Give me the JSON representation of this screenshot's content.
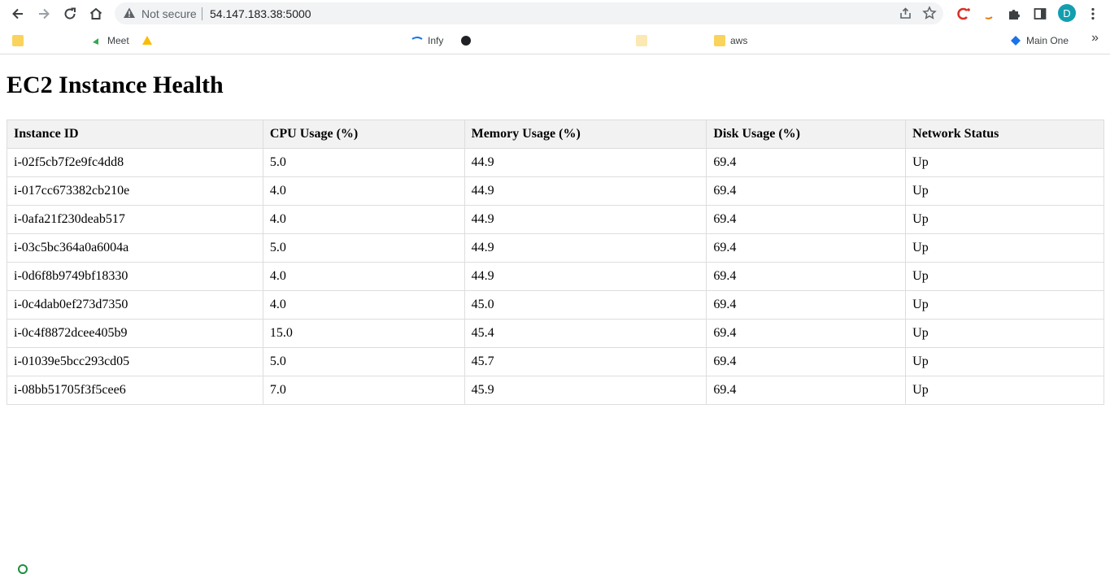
{
  "browser": {
    "security_text": "Not secure",
    "url": "54.147.183.38:5000",
    "profile_initial": "D",
    "bookmarks": [
      {
        "label": "Meet",
        "icon": "meet-icon"
      },
      {
        "label": "Infy",
        "icon": "link-icon"
      },
      {
        "label": "aws",
        "icon": "folder-icon"
      },
      {
        "label": "Main One",
        "icon": "bookmark-icon"
      }
    ]
  },
  "page": {
    "title": "EC2 Instance Health",
    "columns": [
      "Instance ID",
      "CPU Usage (%)",
      "Memory Usage (%)",
      "Disk Usage (%)",
      "Network Status"
    ],
    "rows": [
      [
        "i-02f5cb7f2e9fc4dd8",
        "5.0",
        "44.9",
        "69.4",
        "Up"
      ],
      [
        "i-017cc673382cb210e",
        "4.0",
        "44.9",
        "69.4",
        "Up"
      ],
      [
        "i-0afa21f230deab517",
        "4.0",
        "44.9",
        "69.4",
        "Up"
      ],
      [
        "i-03c5bc364a0a6004a",
        "5.0",
        "44.9",
        "69.4",
        "Up"
      ],
      [
        "i-0d6f8b9749bf18330",
        "4.0",
        "44.9",
        "69.4",
        "Up"
      ],
      [
        "i-0c4dab0ef273d7350",
        "4.0",
        "45.0",
        "69.4",
        "Up"
      ],
      [
        "i-0c4f8872dcee405b9",
        "15.0",
        "45.4",
        "69.4",
        "Up"
      ],
      [
        "i-01039e5bcc293cd05",
        "5.0",
        "45.7",
        "69.4",
        "Up"
      ],
      [
        "i-08bb51705f3f5cee6",
        "7.0",
        "45.9",
        "69.4",
        "Up"
      ]
    ]
  }
}
